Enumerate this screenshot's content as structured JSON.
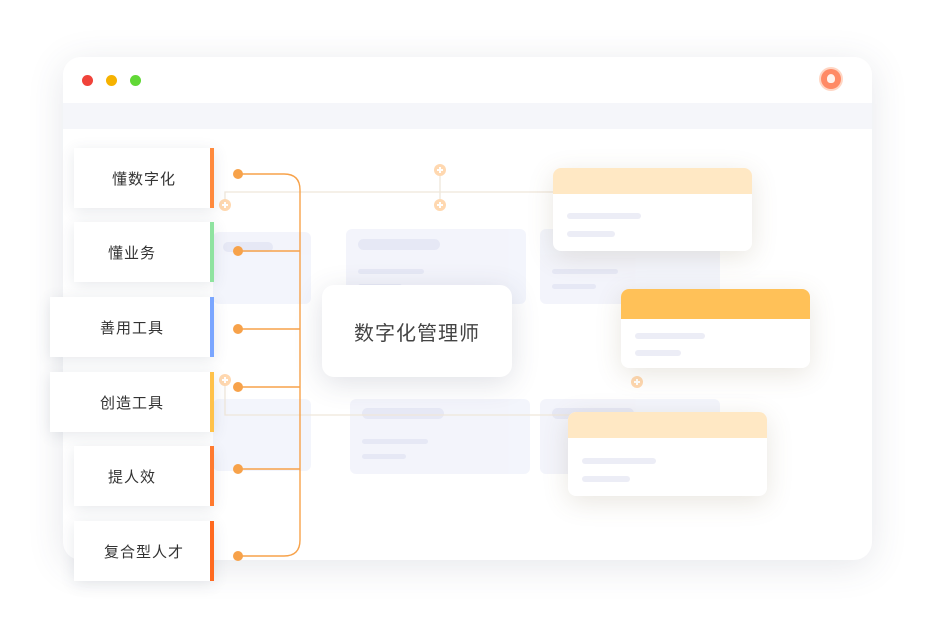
{
  "window": {
    "traffic_lights": [
      "#f0433a",
      "#f6b200",
      "#61d836"
    ],
    "avatar_icon": "user-avatar-icon"
  },
  "center": {
    "label": "数字化管理师"
  },
  "skills": [
    {
      "label": "懂数字化",
      "accent": "#ff8a3d"
    },
    {
      "label": "懂业务",
      "accent": "#8fe3a0"
    },
    {
      "label": "善用工具",
      "accent": "#7aa6ff"
    },
    {
      "label": "创造工具",
      "accent": "#ffc24a"
    },
    {
      "label": "提人效",
      "accent": "#ff7a2f"
    },
    {
      "label": "复合型人才",
      "accent": "#ff6a20"
    }
  ],
  "colors": {
    "connector": "#f7a24a",
    "card_header_light": "#ffe8c4",
    "card_header_strong": "#ffc158"
  }
}
